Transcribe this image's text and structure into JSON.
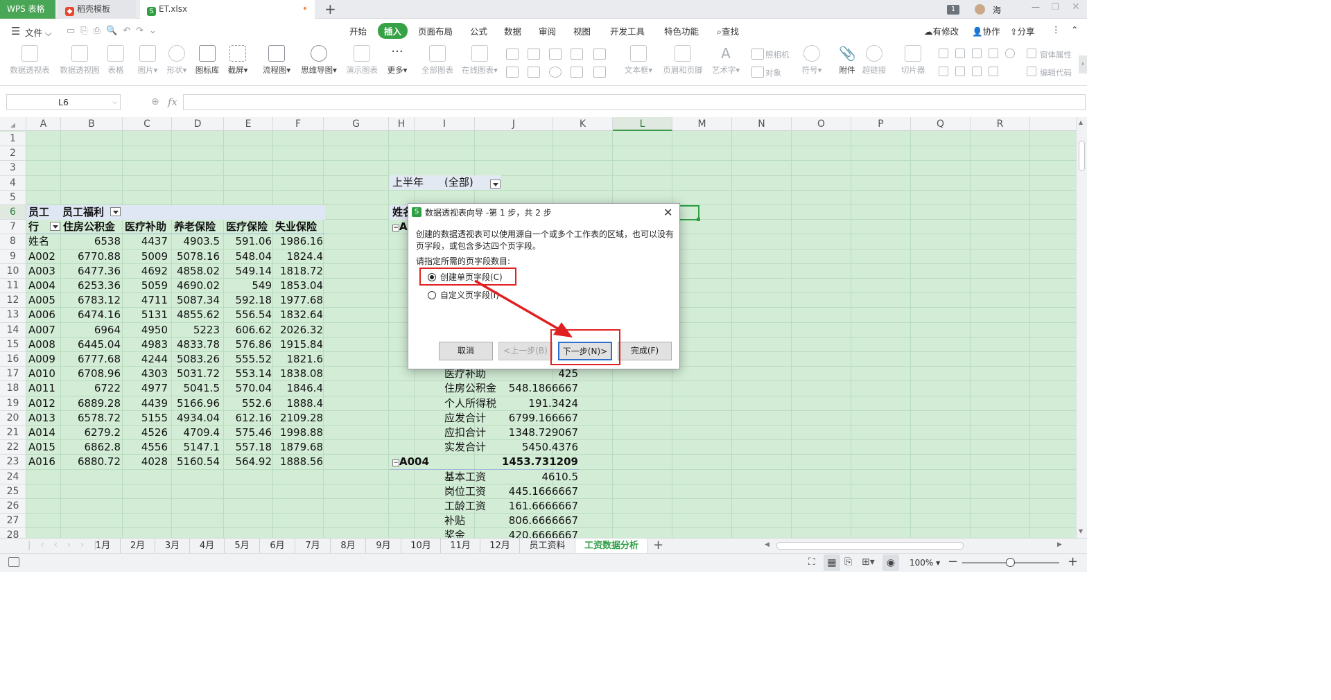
{
  "tabs": {
    "wps": "WPS 表格",
    "daoke": "稻壳模板",
    "file": "ET.xlsx",
    "badge": "1",
    "user": "海"
  },
  "menu": {
    "file": "文件",
    "items": [
      "开始",
      "插入",
      "页面布局",
      "公式",
      "数据",
      "审阅",
      "视图",
      "开发工具",
      "特色功能"
    ],
    "active_index": 1,
    "search": "查找",
    "right": [
      "有修改",
      "协作",
      "分享"
    ]
  },
  "ribbon": {
    "items": [
      "数据透视表",
      "数据透视图",
      "表格",
      "图片",
      "形状",
      "图标库",
      "截屏",
      "流程图",
      "思维导图",
      "演示图表",
      "更多",
      "全部图表",
      "在线图表",
      "文本框",
      "页眉和页脚",
      "艺术字",
      "符号",
      "附件",
      "超链接",
      "切片器"
    ],
    "small": [
      "照相机",
      "对象",
      "窗体属性",
      "编辑代码"
    ]
  },
  "formula": {
    "cell_ref": "L6",
    "fx": "fx",
    "value": ""
  },
  "columns": [
    "A",
    "B",
    "C",
    "D",
    "E",
    "F",
    "G",
    "H",
    "I",
    "J",
    "K",
    "L",
    "M",
    "N",
    "O",
    "P",
    "Q",
    "R"
  ],
  "selected_col": "L",
  "selected_row": "6",
  "rows": [
    "1",
    "2",
    "3",
    "4",
    "5",
    "6",
    "7",
    "8",
    "9",
    "10",
    "11",
    "12",
    "13",
    "14",
    "15",
    "16",
    "17",
    "18",
    "19",
    "20",
    "21",
    "22",
    "23",
    "24",
    "25",
    "26",
    "27",
    "28"
  ],
  "pivot1": {
    "header1": [
      "员工",
      "员工福利"
    ],
    "header2": [
      "行",
      "住房公积金",
      "医疗补助",
      "养老保险",
      "医疗保险",
      "失业保险"
    ],
    "data": [
      [
        "姓名",
        "6538",
        "4437",
        "4903.5",
        "591.06",
        "1986.16"
      ],
      [
        "A002",
        "6770.88",
        "5009",
        "5078.16",
        "548.04",
        "1824.4"
      ],
      [
        "A003",
        "6477.36",
        "4692",
        "4858.02",
        "549.14",
        "1818.72"
      ],
      [
        "A004",
        "6253.36",
        "5059",
        "4690.02",
        "549",
        "1853.04"
      ],
      [
        "A005",
        "6783.12",
        "4711",
        "5087.34",
        "592.18",
        "1977.68"
      ],
      [
        "A006",
        "6474.16",
        "5131",
        "4855.62",
        "556.54",
        "1832.64"
      ],
      [
        "A007",
        "6964",
        "4950",
        "5223",
        "606.62",
        "2026.32"
      ],
      [
        "A008",
        "6445.04",
        "4983",
        "4833.78",
        "576.86",
        "1915.84"
      ],
      [
        "A009",
        "6777.68",
        "4244",
        "5083.26",
        "555.52",
        "1821.6"
      ],
      [
        "A010",
        "6708.96",
        "4303",
        "5031.72",
        "553.14",
        "1838.08"
      ],
      [
        "A011",
        "6722",
        "4977",
        "5041.5",
        "570.04",
        "1846.4"
      ],
      [
        "A012",
        "6889.28",
        "4439",
        "5166.96",
        "552.6",
        "1888.4"
      ],
      [
        "A013",
        "6578.72",
        "5155",
        "4934.04",
        "612.16",
        "2109.28"
      ],
      [
        "A014",
        "6279.2",
        "4526",
        "4709.4",
        "575.46",
        "1998.88"
      ],
      [
        "A015",
        "6862.8",
        "4556",
        "5147.1",
        "557.18",
        "1879.68"
      ],
      [
        "A016",
        "6880.72",
        "4028",
        "5160.54",
        "564.92",
        "1888.56"
      ]
    ]
  },
  "pivot2": {
    "filter_label": "上半年",
    "filter_value": "(全部)",
    "row6": "姓名",
    "row7": "A",
    "items": [
      [
        "医疗补助",
        "425"
      ],
      [
        "住房公积金",
        "548.1866667"
      ],
      [
        "个人所得税",
        "191.3424"
      ],
      [
        "应发合计",
        "6799.166667"
      ],
      [
        "应扣合计",
        "1348.729067"
      ],
      [
        "实发合计",
        "5450.4376"
      ]
    ],
    "group": "A004",
    "group_value": "1453.731209",
    "items2": [
      [
        "基本工资",
        "4610.5"
      ],
      [
        "岗位工资",
        "445.1666667"
      ],
      [
        "工龄工资",
        "161.6666667"
      ],
      [
        "补贴",
        "806.6666667"
      ],
      [
        "奖金",
        "420.6666667"
      ]
    ]
  },
  "dialog": {
    "title": "数据透视表向导 -第 1 步，共 2 步",
    "desc": "创建的数据透视表可以使用源自一个或多个工作表的区域，也可以没有页字段，或包含多达四个页字段。",
    "prompt": "请指定所需的页字段数目:",
    "option1": "创建单页字段(C)",
    "option2": "自定义页字段(I)",
    "cancel": "取消",
    "prev": "<上一步(B)",
    "next": "下一步(N)>",
    "finish": "完成(F)"
  },
  "sheets": [
    "1月",
    "2月",
    "3月",
    "4月",
    "5月",
    "6月",
    "7月",
    "8月",
    "9月",
    "10月",
    "11月",
    "12月",
    "员工资料",
    "工资数据分析"
  ],
  "active_sheet_index": 13,
  "status": {
    "zoom": "100%"
  },
  "colors": {
    "accent": "#37a146",
    "annotation": "#e02020",
    "grid_bg": "#d2ecd6"
  }
}
